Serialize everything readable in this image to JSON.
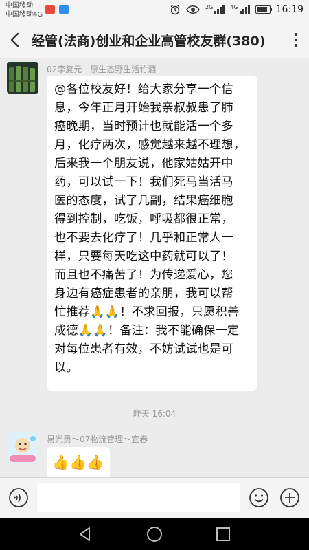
{
  "status_bar": {
    "carrier_1": "中国移动",
    "carrier_2": "中国移动4G",
    "network_1": "2G",
    "network_2": "4G",
    "time": "16:19",
    "battery_level": 0.85
  },
  "header": {
    "title": "经管(法商)创业和企业高管校友群(380)"
  },
  "messages": [
    {
      "sender": "02李复元一原生态野生活竹酒",
      "text": "@各位校友好！给大家分享一个信\n息，今年正月开始我亲叔叔患了肺\n癌晚期，当时预计也就能活一个多\n月，化疗两次，感觉越来越不理想，\n后来我一个朋友说，他家姑姑开中\n药，可以试一下！我们死马当活马\n医的态度，试了几副，结果癌细胞\n得到控制，吃饭，呼吸都很正常，\n也不要去化疗了！几乎和正常人一\n样，只要每天吃这中药就可以了！\n而且也不痛苦了！为传递爱心，您\n身边有癌症患者的亲朋，我可以帮\n忙推荐🙏🙏！不求回报，只愿积善\n成德🙏🙏！备注：我不能确保一定\n对每位患者有效，不妨试试也是可\n以。"
    },
    {
      "sender": "易光勇～07物流管理～宜春",
      "text": "👍👍👍"
    }
  ],
  "timestamp": "昨天 16:04",
  "input": {
    "value": ""
  },
  "icons": {
    "back": "back-arrow-icon",
    "menu": "more-vertical-icon",
    "voice": "voice-icon",
    "emoji": "emoji-icon",
    "plus": "plus-icon"
  }
}
